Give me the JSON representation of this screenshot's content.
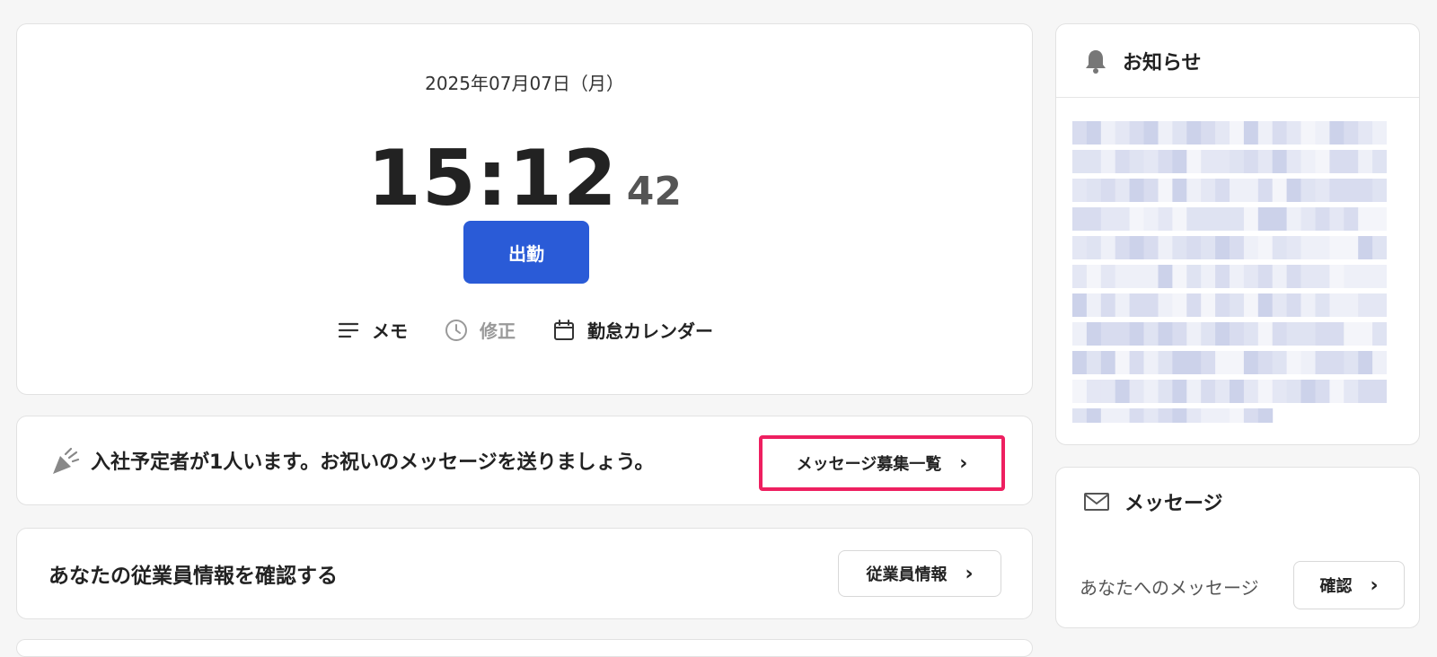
{
  "clock": {
    "date": "2025年07月07日（月）",
    "time_hm": "15:12",
    "time_sec": "42",
    "clock_in_label": "出勤",
    "actions": [
      {
        "label": "メモ",
        "icon": "memo-lines-icon"
      },
      {
        "label": "修正",
        "icon": "clock-icon"
      },
      {
        "label": "勤怠カレンダー",
        "icon": "calendar-icon"
      }
    ]
  },
  "hire_notice": {
    "text": "入社予定者が1人います。お祝いのメッセージを送りましょう。",
    "icon": "party-popper-icon",
    "button_label": "メッセージ募集一覧",
    "highlight_color": "#ee1f60"
  },
  "employee_info": {
    "text": "あなたの従業員情報を確認する",
    "button_label": "従業員情報"
  },
  "news": {
    "title": "お知らせ",
    "icon": "bell-icon"
  },
  "messages": {
    "title": "メッセージ",
    "icon": "envelope-icon",
    "text": "あなたへのメッセージ",
    "button_label": "確認"
  },
  "colors": {
    "primary": "#2a5bd7",
    "highlight": "#ee1f60"
  }
}
